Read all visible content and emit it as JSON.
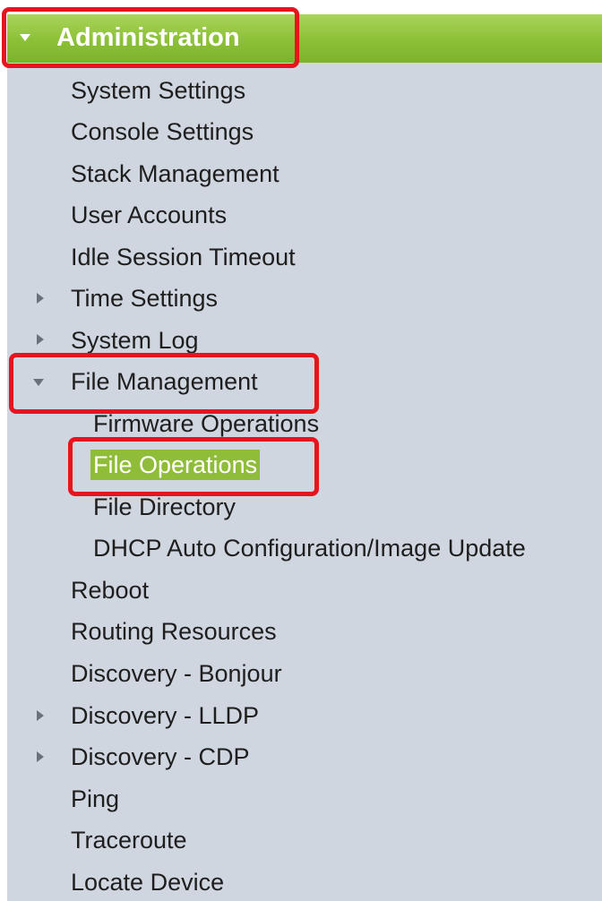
{
  "header": {
    "title": "Administration",
    "color": "#8cc037"
  },
  "menu": {
    "items": [
      {
        "label": "System Settings"
      },
      {
        "label": "Console Settings"
      },
      {
        "label": "Stack Management"
      },
      {
        "label": "User Accounts"
      },
      {
        "label": "Idle Session Timeout"
      },
      {
        "label": "Time Settings",
        "expandable": true
      },
      {
        "label": "System Log",
        "expandable": true
      },
      {
        "label": "File Management",
        "expanded": true,
        "children": [
          {
            "label": "Firmware Operations"
          },
          {
            "label": "File Operations",
            "selected": true
          },
          {
            "label": "File Directory"
          },
          {
            "label": "DHCP Auto Configuration/Image Update"
          }
        ]
      },
      {
        "label": "Reboot"
      },
      {
        "label": "Routing Resources"
      },
      {
        "label": "Discovery - Bonjour"
      },
      {
        "label": "Discovery - LLDP",
        "expandable": true
      },
      {
        "label": "Discovery - CDP",
        "expandable": true
      },
      {
        "label": "Ping"
      },
      {
        "label": "Traceroute"
      },
      {
        "label": "Locate Device"
      }
    ]
  },
  "annotation_color": "#e5141d",
  "selected_color": "#8fbd3a"
}
